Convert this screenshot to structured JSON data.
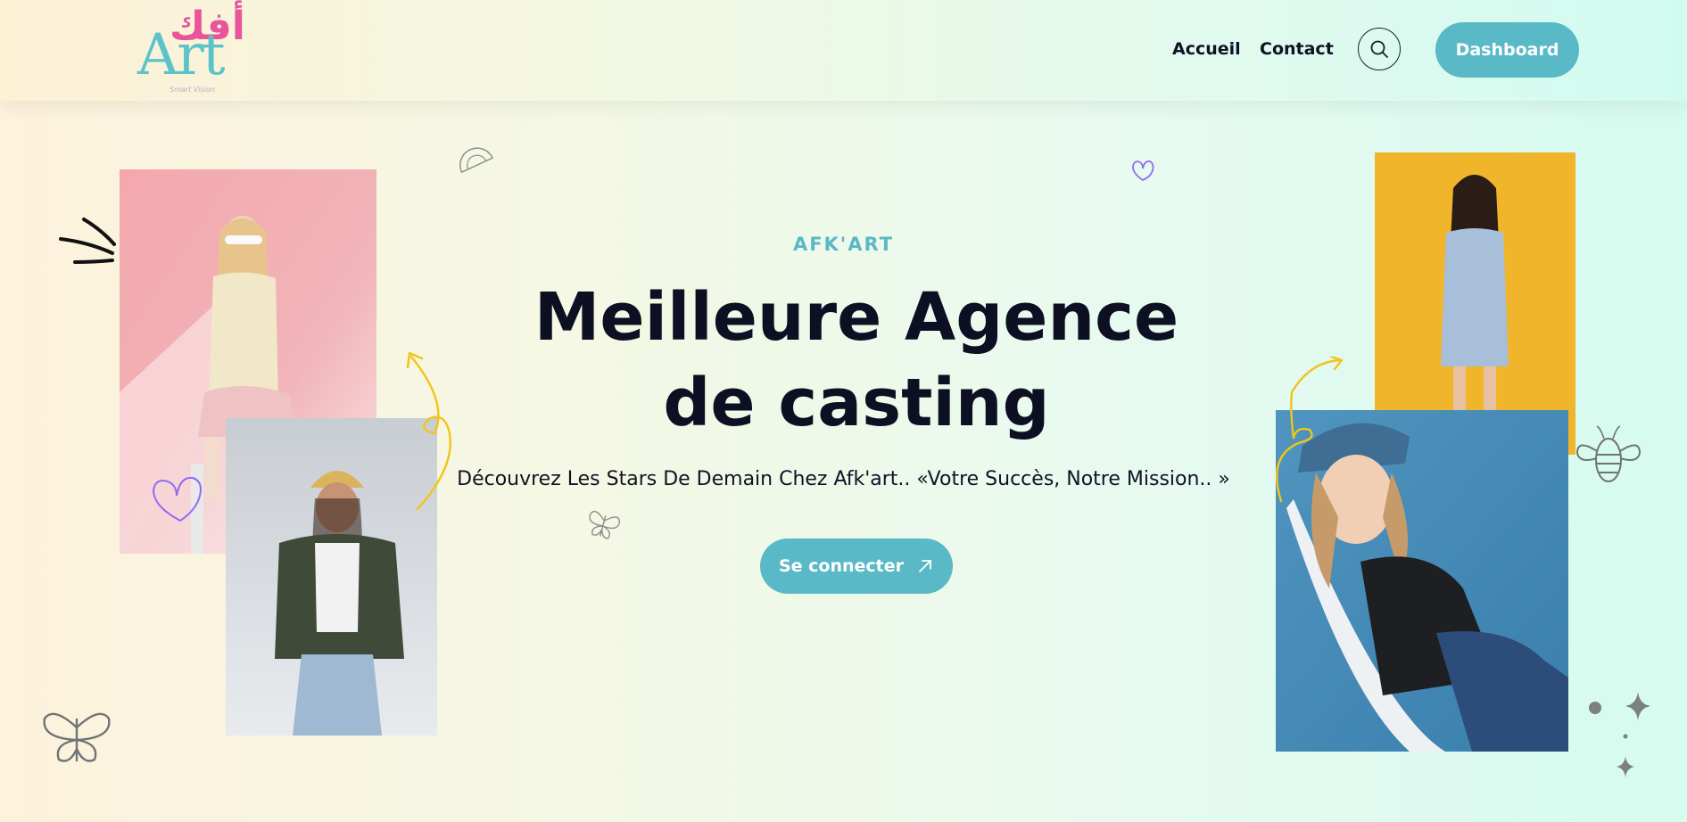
{
  "header": {
    "logo": {
      "arabic": "أفك",
      "latin": "Art",
      "tagline": "Smart Vision"
    },
    "nav": [
      {
        "label": "Accueil"
      },
      {
        "label": "Contact"
      }
    ],
    "search_icon": "search-icon",
    "dashboard_label": "Dashboard"
  },
  "hero": {
    "eyebrow": "AFK'ART",
    "title": "Meilleure Agence de casting",
    "subtitle": "Découvrez Les Stars De Demain Chez Afk'art.. «Votre Succès, Notre Mission.. »",
    "cta_label": "Se connecter",
    "cta_icon": "arrow-up-right-icon"
  },
  "colors": {
    "accent": "#5ab9c6",
    "title": "#0d0f22",
    "logo_pink": "#e8559a",
    "logo_teal": "#5ec3c9",
    "doodle_yellow": "#f2c418",
    "doodle_purple": "#8f6cf0"
  }
}
